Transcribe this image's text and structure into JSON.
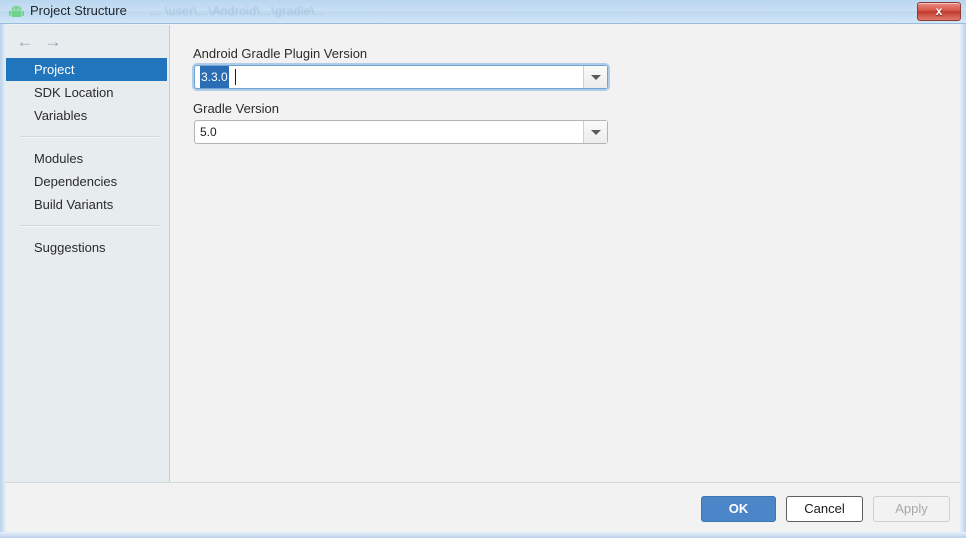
{
  "window": {
    "title": "Project Structure",
    "icon": "android-robot-icon",
    "ghost_text": "... \\user\\...\\Android\\...\\gradle\\...",
    "close_label": "x",
    "accent_blue": "#2175bc",
    "ok_blue": "#4a86c8",
    "titlebar_blue": "#c9e0f4"
  },
  "sidebar": {
    "nav": {
      "back_icon": "arrow-left-icon",
      "back_glyph": "←",
      "forward_icon": "arrow-right-icon",
      "forward_glyph": "→"
    },
    "groups": [
      {
        "items": [
          {
            "label": "Project",
            "selected": true
          },
          {
            "label": "SDK Location",
            "selected": false
          },
          {
            "label": "Variables",
            "selected": false
          }
        ]
      },
      {
        "items": [
          {
            "label": "Modules",
            "selected": false
          },
          {
            "label": "Dependencies",
            "selected": false
          },
          {
            "label": "Build Variants",
            "selected": false
          }
        ]
      },
      {
        "items": [
          {
            "label": "Suggestions",
            "selected": false
          }
        ]
      }
    ]
  },
  "main": {
    "fields": [
      {
        "label": "Android Gradle Plugin Version",
        "value": "3.3.0",
        "focused": true,
        "text_selected": true
      },
      {
        "label": "Gradle Version",
        "value": "5.0",
        "focused": false,
        "text_selected": false
      }
    ],
    "dropdown_icon": "chevron-down-icon"
  },
  "buttons": {
    "ok": "OK",
    "cancel": "Cancel",
    "apply": "Apply"
  }
}
